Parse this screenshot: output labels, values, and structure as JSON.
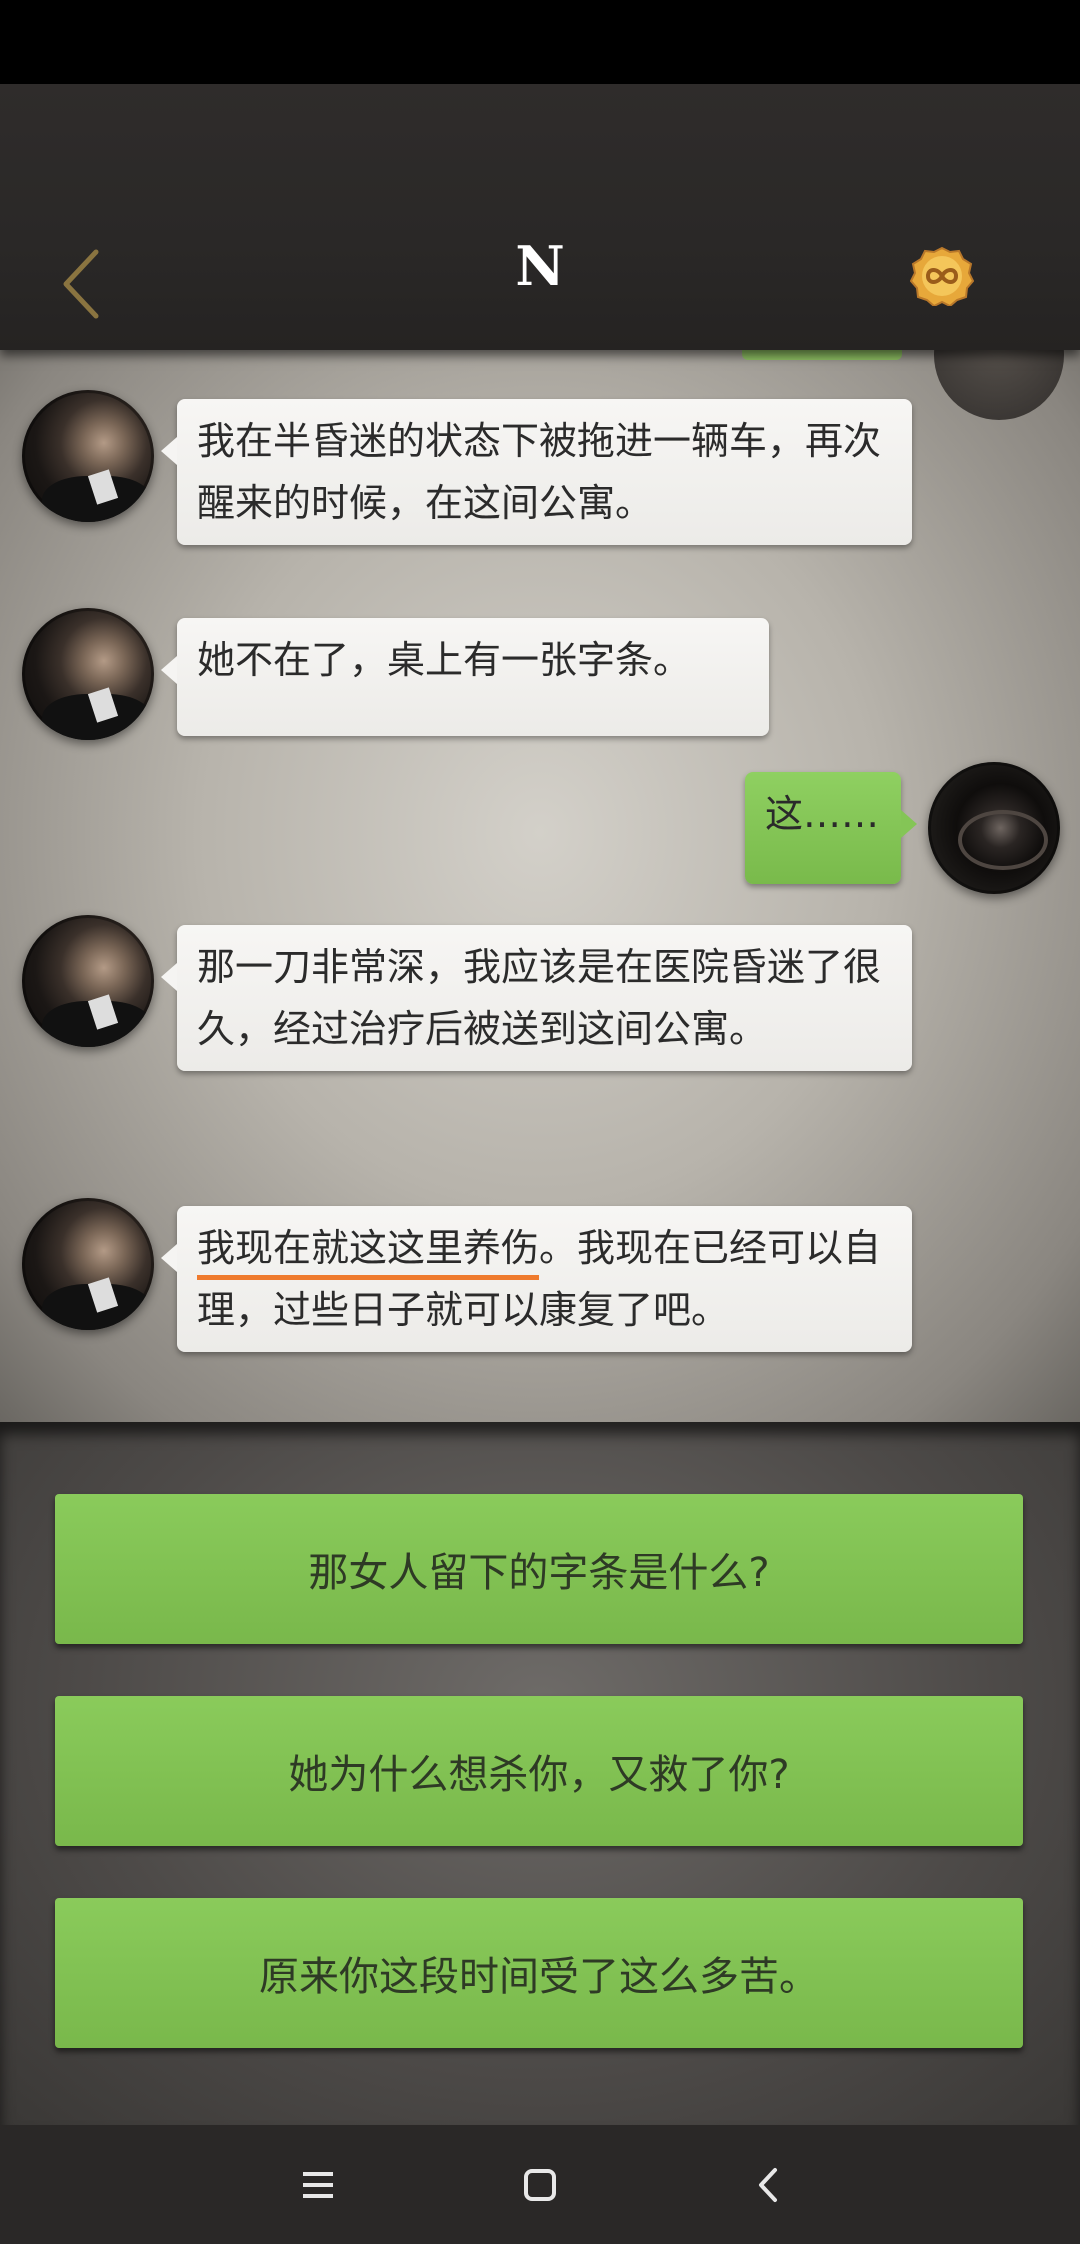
{
  "header": {
    "title": "N",
    "back_icon": "chevron-left-icon",
    "badge_icon": "infinity-coin-icon"
  },
  "messages": [
    {
      "side": "left",
      "text": "我在半昏迷的状态下被拖进一辆车，再次醒来的时候，在这间公寓。"
    },
    {
      "side": "left",
      "text": "她不在了，桌上有一张字条。"
    },
    {
      "side": "right",
      "text": "这……"
    },
    {
      "side": "left",
      "text": "那一刀非常深，我应该是在医院昏迷了很久，经过治疗后被送到这间公寓。"
    },
    {
      "side": "left",
      "underlined": "我现在就这这里养伤",
      "rest": "。我现在已经可以自理，过些日子就可以康复了吧。"
    }
  ],
  "choices": [
    "那女人留下的字条是什么?",
    "她为什么想杀你，又救了你?",
    "原来你这段时间受了这么多苦。"
  ],
  "nav": {
    "menu_icon": "menu-icon",
    "home_icon": "home-square-icon",
    "back_icon": "back-triangle-icon"
  },
  "colors": {
    "accent_green": "#8acb5b",
    "underline_orange": "#ef7a2d",
    "header_bg": "#2c2a29"
  }
}
